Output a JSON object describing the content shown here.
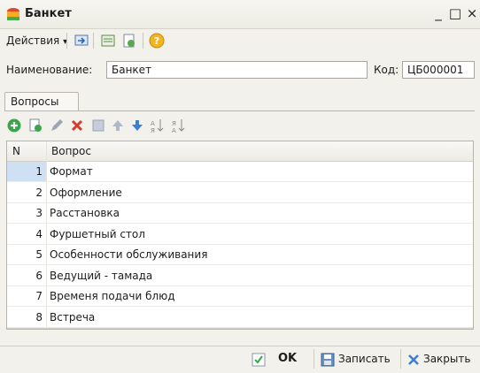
{
  "window": {
    "title": "Банкет",
    "controls": [
      "_",
      "□",
      "×"
    ]
  },
  "toolbar": {
    "actions_label": "Действия",
    "dropdown_glyph": "▾"
  },
  "form": {
    "name_label": "Наименование:",
    "name_value": "Банкет",
    "code_label": "Код:",
    "code_value": "ЦБ000001"
  },
  "tab": {
    "label": "Вопросы"
  },
  "table": {
    "columns": [
      "N",
      "Вопрос"
    ],
    "rows": [
      {
        "n": "1",
        "text": "Формат"
      },
      {
        "n": "2",
        "text": "Оформление"
      },
      {
        "n": "3",
        "text": "Расстановка"
      },
      {
        "n": "4",
        "text": "Фуршетный стол"
      },
      {
        "n": "5",
        "text": "Особенности обслуживания"
      },
      {
        "n": "6",
        "text": "Ведущий - тамада"
      },
      {
        "n": "7",
        "text": "Временя подачи блюд"
      },
      {
        "n": "8",
        "text": "Встреча"
      }
    ],
    "selected_index": 0
  },
  "footer": {
    "ok_label": "OK",
    "save_label": "Записать",
    "close_label": "Закрыть"
  },
  "colors": {
    "accent_blue": "#3d7fd1",
    "delete_red": "#d33b2c",
    "add_green": "#3aa54a",
    "selected_row": "#cfe0f4"
  }
}
